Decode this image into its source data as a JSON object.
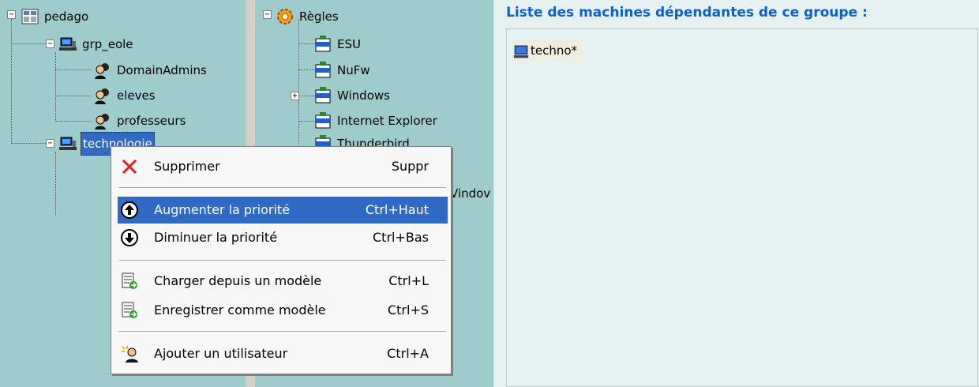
{
  "left_tree": {
    "root": {
      "label": "pedago"
    },
    "groups": [
      {
        "label": "grp_eole",
        "children": [
          "DomainAdmins",
          "eleves",
          "professeurs"
        ]
      },
      {
        "label": "technologie"
      }
    ]
  },
  "middle_tree": {
    "root": {
      "label": "Règles"
    },
    "items": [
      "ESU",
      "NuFw",
      "Windows",
      "Internet Explorer",
      "Thunderbird"
    ],
    "partial_text": "Vindov"
  },
  "context_menu": {
    "items": [
      {
        "label": "Supprimer",
        "shortcut": "Suppr",
        "icon": "delete-x-icon"
      },
      {
        "label": "Augmenter la priorité",
        "shortcut": "Ctrl+Haut",
        "icon": "arrow-up-circle-icon"
      },
      {
        "label": "Diminuer la priorité",
        "shortcut": "Ctrl+Bas",
        "icon": "arrow-down-circle-icon"
      },
      {
        "label": "Charger depuis un modèle",
        "shortcut": "Ctrl+L",
        "icon": "load-template-icon"
      },
      {
        "label": "Enregistrer comme modèle",
        "shortcut": "Ctrl+S",
        "icon": "save-template-icon"
      },
      {
        "label": "Ajouter un utilisateur",
        "shortcut": "Ctrl+A",
        "icon": "add-user-icon"
      }
    ]
  },
  "right_panel": {
    "title": "Liste des machines dépendantes de ce groupe :",
    "machines": [
      "techno*"
    ]
  },
  "colors": {
    "tree_bg": "#9ecbcb",
    "selection": "#316ac5",
    "title_blue": "#0b5fd1",
    "panel_bg": "#e6f2f2"
  }
}
